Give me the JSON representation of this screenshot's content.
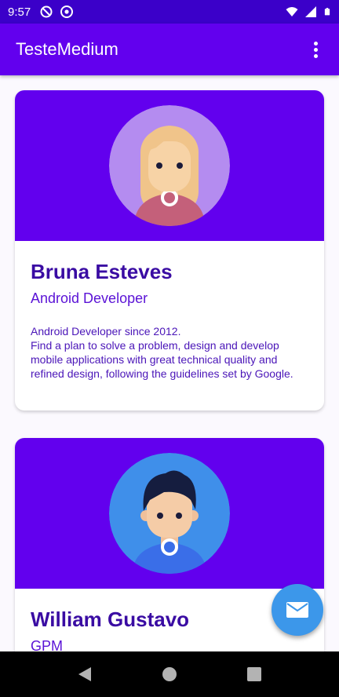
{
  "status_bar": {
    "time": "9:57"
  },
  "app_bar": {
    "title": "TesteMedium"
  },
  "cards": [
    {
      "name": "Bruna Esteves",
      "role": "Android Developer",
      "description": "Android Developer since 2012.\nFind a plan to solve a problem, design and develop mobile applications with great technical quality and refined design, following the guidelines set by Google."
    },
    {
      "name": "William Gustavo",
      "role": "GPM"
    }
  ],
  "icons": {
    "fab": "mail-icon",
    "overflow": "more-vert-icon",
    "nav": [
      "back-icon",
      "home-icon",
      "recents-icon"
    ]
  },
  "colors": {
    "primary": "#6200ee",
    "status_bar": "#3b00c9",
    "fab": "#3c97ea",
    "name_text": "#3a0ca3"
  }
}
